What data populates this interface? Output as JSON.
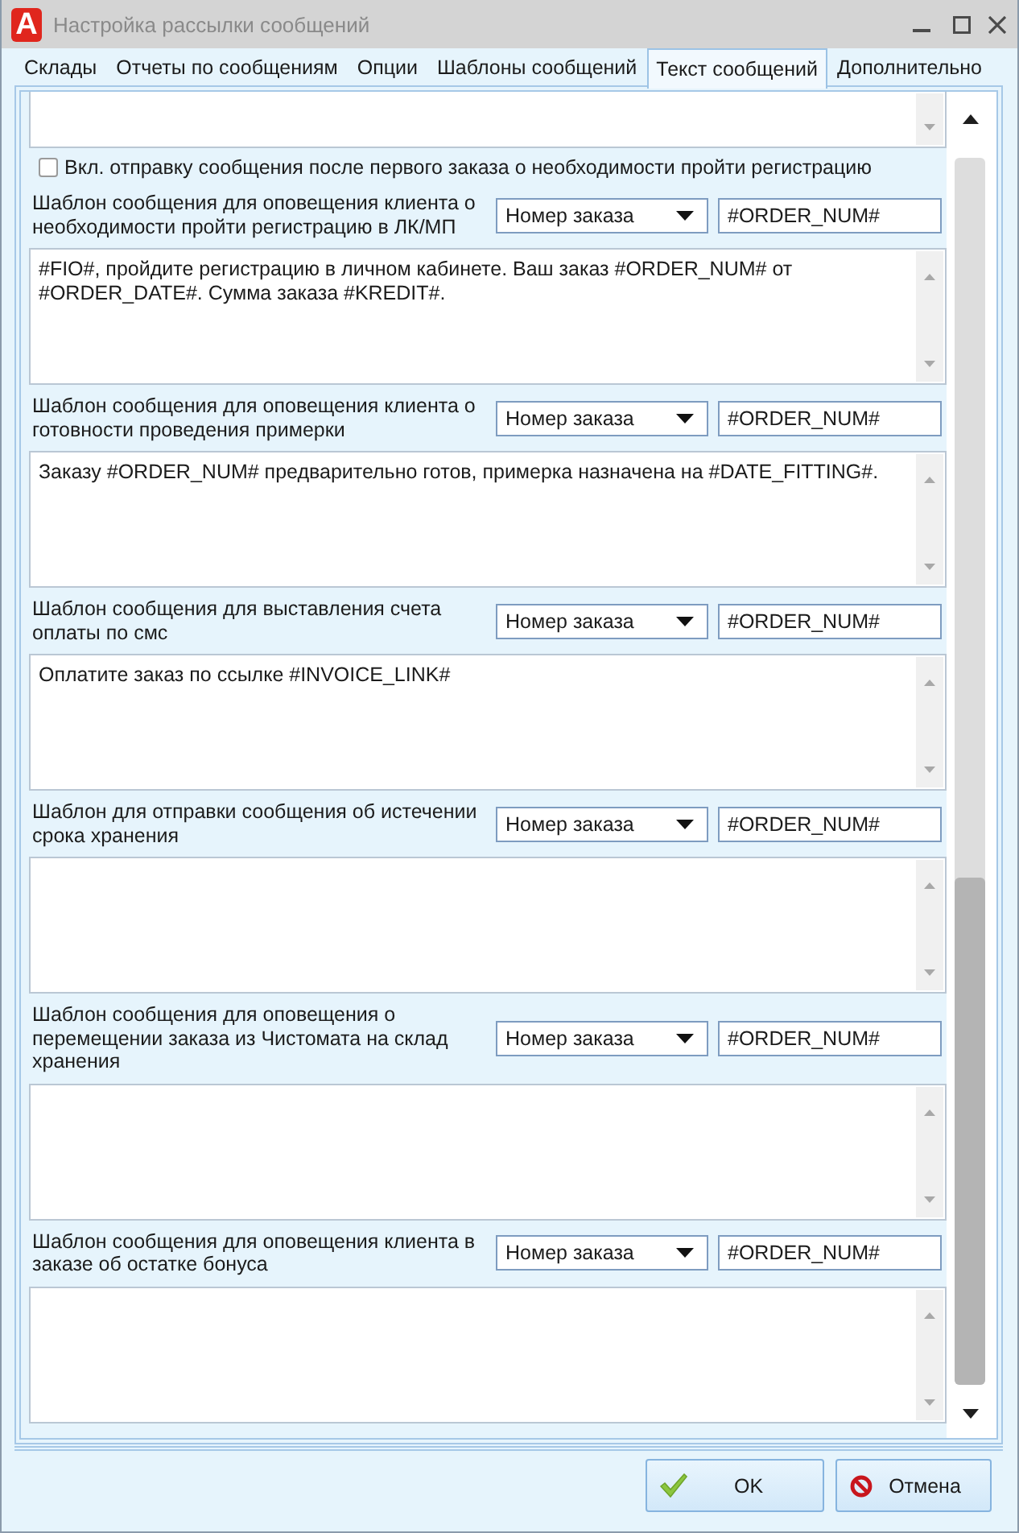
{
  "window": {
    "title": "Настройка рассылки сообщений",
    "logo": "A"
  },
  "tabs": [
    {
      "label": "Склады",
      "selected": false
    },
    {
      "label": "Отчеты по сообщениям",
      "selected": false
    },
    {
      "label": "Опции",
      "selected": false
    },
    {
      "label": "Шаблоны сообщений",
      "selected": false
    },
    {
      "label": "Текст сообщений",
      "selected": true
    },
    {
      "label": "Дополнительно",
      "selected": false
    }
  ],
  "registration_checkbox": {
    "label": "Вкл. отправку сообщения после первого заказа о необходимости пройти регистрацию",
    "checked": false
  },
  "templates": [
    {
      "label": "Шаблон сообщения для оповещения клиента о необходимости пройти регистрацию в ЛК/МП",
      "variable_dropdown": "Номер заказа",
      "variable_code": "#ORDER_NUM#",
      "message": "#FIO#, пройдите регистрацию в личном кабинете. Ваш заказ #ORDER_NUM# от #ORDER_DATE#. Сумма заказа #KREDIT#."
    },
    {
      "label": "Шаблон сообщения для оповещения клиента о готовности проведения примерки",
      "variable_dropdown": "Номер заказа",
      "variable_code": "#ORDER_NUM#",
      "message": "Заказу #ORDER_NUM# предварительно готов, примерка назначена на #DATE_FITTING#."
    },
    {
      "label": "Шаблон сообщения для выставления счета оплаты по смс",
      "variable_dropdown": "Номер заказа",
      "variable_code": "#ORDER_NUM#",
      "message": "Оплатите заказ по ссылке #INVOICE_LINK#"
    },
    {
      "label": "Шаблон для отправки сообщения об истечении срока хранения",
      "variable_dropdown": "Номер заказа",
      "variable_code": "#ORDER_NUM#"
    },
    {
      "label": "Шаблон сообщения для оповещения о перемещении заказа из Чистомата на склад хранения",
      "variable_dropdown": "Номер заказа",
      "variable_code": "#ORDER_NUM#"
    },
    {
      "label": "Шаблон сообщения для оповещения клиента в заказе об остатке бонуса",
      "variable_dropdown": "Номер заказа",
      "variable_code": "#ORDER_NUM#"
    }
  ],
  "buttons": [
    {
      "label": "OK",
      "kind": "ok"
    },
    {
      "label": "Отмена",
      "kind": "cancel"
    }
  ]
}
